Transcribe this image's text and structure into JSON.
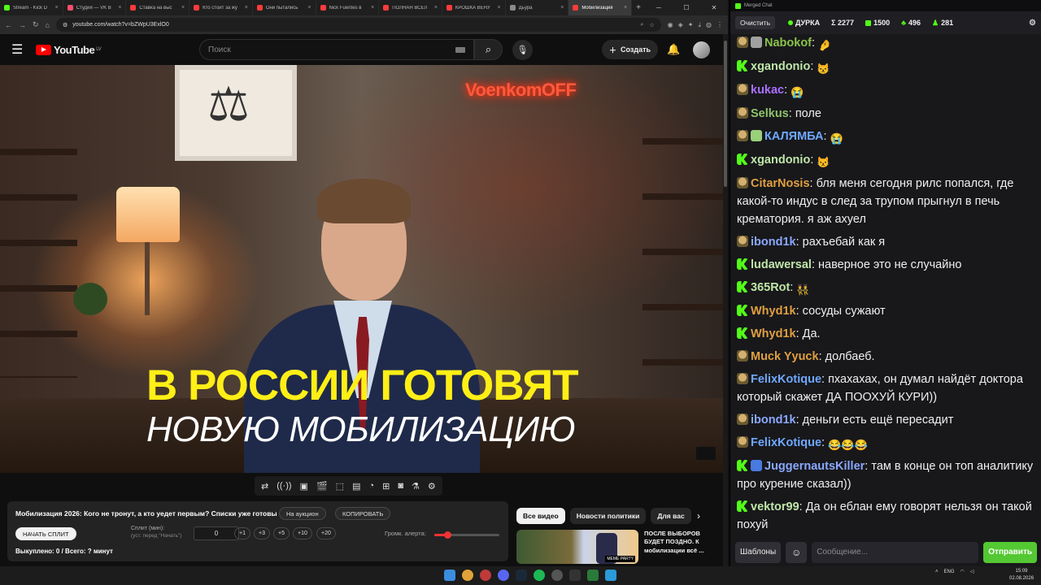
{
  "browser": {
    "tabs": [
      {
        "label": "Stream - Kick D",
        "color": "#53fc18"
      },
      {
        "label": "Студия — VK В",
        "color": "#ff4d6d"
      },
      {
        "label": "Ставка на выс",
        "color": "#ff3b3b"
      },
      {
        "label": "Кто стоит за жу",
        "color": "#ff3b3b"
      },
      {
        "label": "Они пытались",
        "color": "#ff3b3b"
      },
      {
        "label": "Nick Fuentes в",
        "color": "#ff3b3b"
      },
      {
        "label": "ПОЛНАЯ ВСЕЛ",
        "color": "#ff3b3b"
      },
      {
        "label": "КРОШКА ВЕНУ",
        "color": "#ff3b3b"
      },
      {
        "label": "Дьура",
        "color": "#8a8a8a"
      },
      {
        "label": "Мобилизация",
        "color": "#ff3b3b"
      }
    ],
    "active_tab": 9,
    "url": "youtube.com/watch?v=bZWpU3ExlO0"
  },
  "youtube": {
    "logo_text": "YouTube",
    "region": "LV",
    "search_placeholder": "Поиск",
    "create_label": "Создать"
  },
  "video": {
    "neon_sign": "VoenkomOFF",
    "caption_line1": "В РОССИИ ГОТОВЯТ",
    "caption_line2": "НОВУЮ МОБИЛИЗАЦИЮ"
  },
  "toolbar_icons": [
    "loop-icon",
    "broadcast-icon",
    "screenshot-icon",
    "clapper-icon",
    "crop-icon",
    "cinema-icon",
    "speed-icon",
    "add-icon",
    "camera-icon",
    "flask-icon",
    "gear-icon"
  ],
  "panel": {
    "title": "Мобилизация 2026: Кого не тронут, а кто уедет первым? Списки уже готовы",
    "auction_label": "На аукцион",
    "copy_label": "КОПИРОВАТЬ",
    "start_split_label": "НАЧАТЬ СПЛИТ",
    "split_label": "Сплит (мин):",
    "split_hint": "(уст. перед \"Начать\")",
    "split_value": "0",
    "steps": [
      "+1",
      "+3",
      "+5",
      "+10",
      "+20"
    ],
    "alert_label": "Громк. алерта:",
    "alert_volume": 0.2,
    "bought_text": "Выкуплено: 0 / Всего: ? минут"
  },
  "chips": [
    {
      "label": "Все видео",
      "selected": true
    },
    {
      "label": "Новости политики",
      "selected": false
    },
    {
      "label": "Для вас",
      "selected": false
    }
  ],
  "recommendation": {
    "title": "ПОСЛЕ ВЫБОРОВ БУДЕТ ПОЗДНО. К мобилизации всё ...",
    "badge": "MEME PARTY"
  },
  "chat": {
    "window_title": "Merged Chat",
    "clear_label": "Очистить",
    "channel": "ДУРКА",
    "total": "Σ 2277",
    "kick_count": "1500",
    "green_count": "496",
    "other_count": "281",
    "messages": [
      {
        "badges": [
          "yt",
          "shield"
        ],
        "user": "Nabokof",
        "color": "#8bc34a",
        "text": "",
        "emote": "🤌"
      },
      {
        "badges": [
          "k"
        ],
        "user": "xgandonio",
        "color": "#bfe6a8",
        "text": "",
        "emote": "😾"
      },
      {
        "badges": [
          "yt"
        ],
        "user": "kukac",
        "color": "#a970ff",
        "text": "",
        "emote": "😭"
      },
      {
        "badges": [
          "yt"
        ],
        "user": "Selkus",
        "color": "#8fc36a",
        "text": "поле",
        "emote": ""
      },
      {
        "badges": [
          "yt",
          "green"
        ],
        "user": "КАЛЯМБА",
        "color": "#6fa8ff",
        "text": "",
        "emote": "😭"
      },
      {
        "badges": [
          "k"
        ],
        "user": "xgandonio",
        "color": "#bfe6a8",
        "text": "",
        "emote": "😾"
      },
      {
        "badges": [
          "yt"
        ],
        "user": "CitarNosis",
        "color": "#e0a040",
        "text": "бля меня сегодня рилс попался, где какой-то индус в след за трупом прыгнул в печь крематория. я аж ахуел",
        "emote": ""
      },
      {
        "badges": [
          "yt"
        ],
        "user": "ibond1k",
        "color": "#8aa8ff",
        "text": "рахъебай как я",
        "emote": ""
      },
      {
        "badges": [
          "k"
        ],
        "user": "ludawersal",
        "color": "#bfe6a8",
        "text": "наверное это не случайно",
        "emote": ""
      },
      {
        "badges": [
          "k"
        ],
        "user": "365Rot",
        "color": "#bfe6a8",
        "text": "",
        "emote": "👯"
      },
      {
        "badges": [
          "k"
        ],
        "user": "Whyd1k",
        "color": "#e0a040",
        "text": "сосуды сужают",
        "emote": ""
      },
      {
        "badges": [
          "k"
        ],
        "user": "Whyd1k",
        "color": "#e0a040",
        "text": "Да.",
        "emote": ""
      },
      {
        "badges": [
          "yt"
        ],
        "user": "Muck Yyuck",
        "color": "#e0a040",
        "text": "долбаеб.",
        "emote": ""
      },
      {
        "badges": [
          "yt"
        ],
        "user": "FelixKotique",
        "color": "#6fa8ff",
        "text": "пхахахах, он думал найдёт доктора который скажет ДА ПООХУЙ КУРИ))",
        "emote": ""
      },
      {
        "badges": [
          "yt"
        ],
        "user": "ibond1k",
        "color": "#8aa8ff",
        "text": "деньги есть ещё пересадит",
        "emote": ""
      },
      {
        "badges": [
          "yt"
        ],
        "user": "FelixKotique",
        "color": "#6fa8ff",
        "text": "",
        "emote": "😂😂😂"
      },
      {
        "badges": [
          "k",
          "tool"
        ],
        "user": "JuggernautsKiller",
        "color": "#8aa8ff",
        "text": "там в конце  он топ аналитику про курение сказал))",
        "emote": ""
      },
      {
        "badges": [
          "k"
        ],
        "user": "vektor99",
        "color": "#bfe6a8",
        "text": "Да он еблан ему говорят нельзя он такой похуй",
        "emote": ""
      }
    ],
    "templates_label": "Шаблоны",
    "input_placeholder": "Сообщение...",
    "send_label": "Отправить"
  },
  "taskbar": {
    "lang": "ENG",
    "time": "15:09",
    "date": "02.08.2026"
  }
}
